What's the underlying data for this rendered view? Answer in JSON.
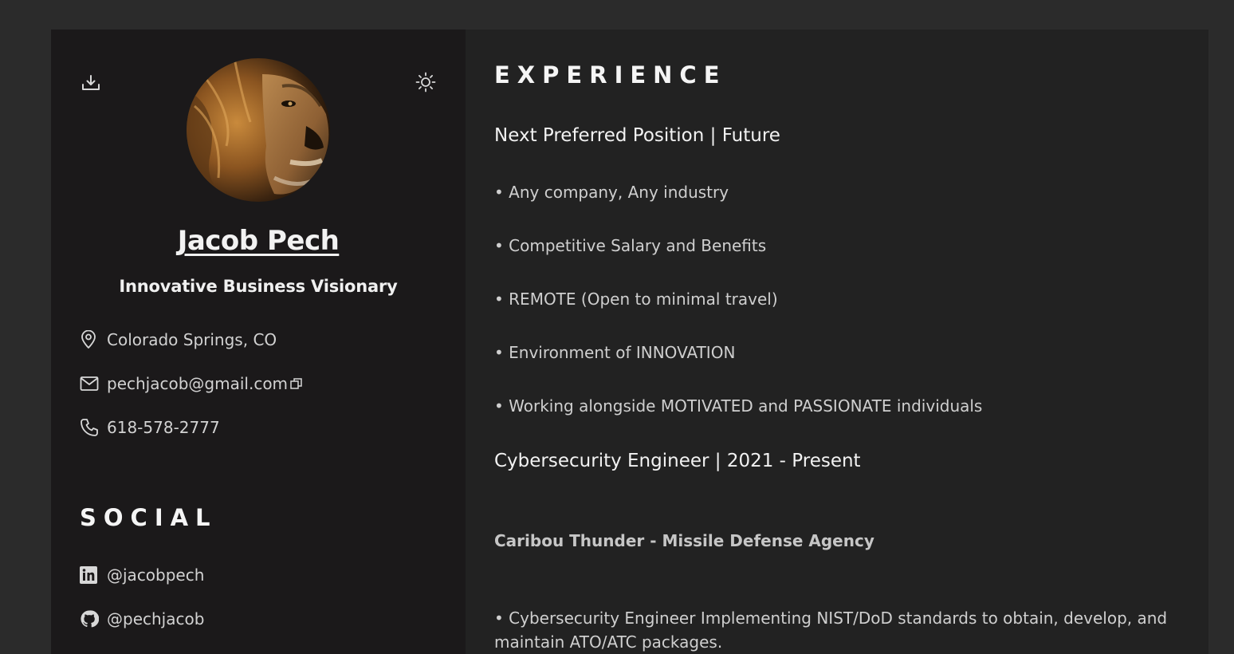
{
  "profile": {
    "name": "Jacob Pech",
    "tagline": "Innovative Business Visionary",
    "location": "Colorado Springs, CO",
    "email": "pechjacob@gmail.com",
    "phone": "618-578-2777",
    "avatar_icon": "lion-photo"
  },
  "toolbar": {
    "download_icon": "download-icon",
    "theme_icon": "sun-icon"
  },
  "social": {
    "heading": "SOCIAL",
    "linkedin": "@jacobpech",
    "github": "@pechjacob"
  },
  "experience": {
    "heading": "EXPERIENCE",
    "jobs": [
      {
        "title": "Next Preferred Position | Future",
        "bullets": [
          "• Any company, Any industry",
          "• Competitive Salary and Benefits",
          "• REMOTE (Open to minimal travel)",
          "• Environment of INNOVATION",
          "• Working alongside MOTIVATED and PASSIONATE individuals"
        ]
      },
      {
        "title": "Cybersecurity Engineer | 2021 - Present",
        "organization": "Caribou Thunder - Missile Defense Agency",
        "bullets": [
          "• Cybersecurity Engineer Implementing NIST/DoD standards to obtain, develop, and maintain ATO/ATC packages."
        ]
      }
    ]
  },
  "colors": {
    "page_bg": "#2b2b2b",
    "sidebar_bg": "#1b191a",
    "main_bg": "#222222",
    "text_primary": "#f2f2f2",
    "text_secondary": "#cfcfcf"
  }
}
